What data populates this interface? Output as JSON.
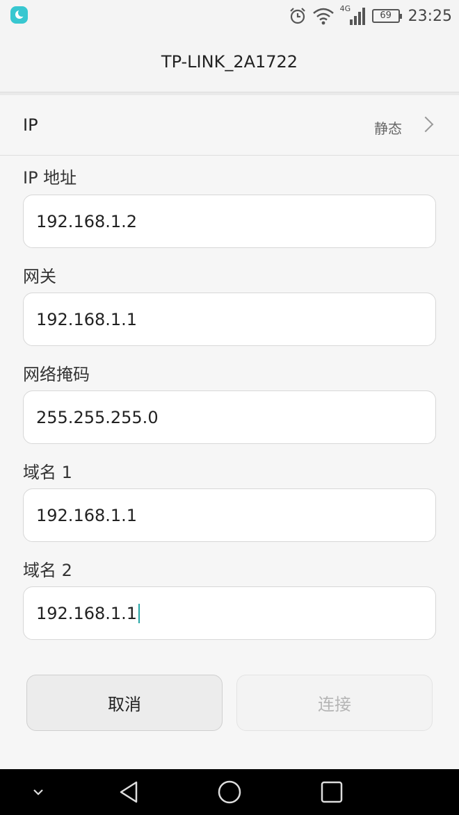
{
  "status_bar": {
    "time": "23:25",
    "battery": "69",
    "network": "4G",
    "icons": [
      "app-icon",
      "alarm-icon",
      "wifi-icon",
      "signal-icon",
      "battery-icon"
    ]
  },
  "header": {
    "title": "TP-LINK_2A1722"
  },
  "ip_setting": {
    "label": "IP",
    "value": "静态"
  },
  "fields": [
    {
      "label": "IP 地址",
      "value": "192.168.1.2"
    },
    {
      "label": "网关",
      "value": "192.168.1.1"
    },
    {
      "label": "网络掩码",
      "value": "255.255.255.0"
    },
    {
      "label": "域名 1",
      "value": "192.168.1.1"
    },
    {
      "label": "域名 2",
      "value": "192.168.1.1"
    }
  ],
  "buttons": {
    "cancel": "取消",
    "connect": "连接"
  },
  "colors": {
    "accent": "#26a6a6",
    "app_icon": "#38c7d0",
    "nav_bar": "#000000"
  }
}
